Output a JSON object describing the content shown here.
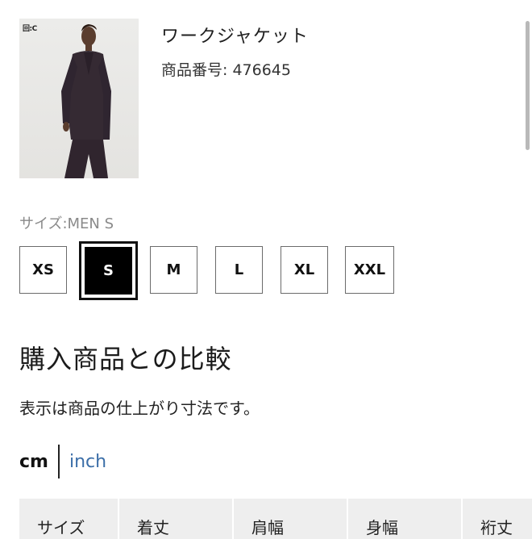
{
  "product": {
    "brand_mark": "回:C",
    "name": "ワークジャケット",
    "number": "商品番号: 476645"
  },
  "size": {
    "label": "サイズ:MEN S",
    "options": [
      "XS",
      "S",
      "M",
      "L",
      "XL",
      "XXL"
    ],
    "selected": "S"
  },
  "compare": {
    "heading": "購入商品との比較",
    "note": "表示は商品の仕上がり寸法です。"
  },
  "units": {
    "cm": "cm",
    "inch": "inch",
    "active": "cm",
    "inch_color": "#3b6ea8"
  },
  "table": {
    "headers": [
      "サイズ",
      "着丈",
      "肩幅",
      "身幅",
      "裄丈"
    ]
  },
  "colors": {
    "selected_bg": "#000000",
    "selected_text": "#ffffff",
    "header_bg": "#eeeeee"
  }
}
